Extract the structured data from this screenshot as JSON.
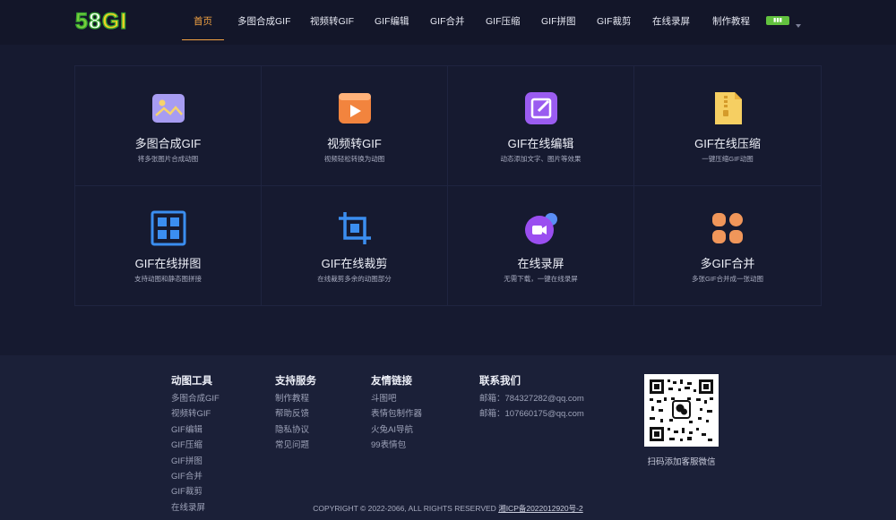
{
  "logo": {
    "chars": [
      "5",
      "8",
      "G",
      "I"
    ]
  },
  "nav": {
    "items": [
      {
        "label": "首页",
        "active": true
      },
      {
        "label": "多图合成GIF"
      },
      {
        "label": "视频转GIF"
      },
      {
        "label": "GIF编辑"
      },
      {
        "label": "GIF合并"
      },
      {
        "label": "GIF压缩"
      },
      {
        "label": "GIF拼图"
      },
      {
        "label": "GIF裁剪"
      },
      {
        "label": "在线录屏"
      },
      {
        "label": "制作教程"
      }
    ],
    "lang_icon": "language-flag-icon"
  },
  "tools": [
    {
      "title": "多图合成GIF",
      "desc": "将多张图片合成动图",
      "icon": "image-icon"
    },
    {
      "title": "视频转GIF",
      "desc": "视频轻松转换为动图",
      "icon": "video-icon"
    },
    {
      "title": "GIF在线编辑",
      "desc": "动态添加文字、图片等效果",
      "icon": "edit-icon"
    },
    {
      "title": "GIF在线压缩",
      "desc": "一键压缩GIF动图",
      "icon": "zip-icon"
    },
    {
      "title": "GIF在线拼图",
      "desc": "支持动图和静态图拼接",
      "icon": "grid-icon"
    },
    {
      "title": "GIF在线裁剪",
      "desc": "在线裁剪多余的动图部分",
      "icon": "crop-icon"
    },
    {
      "title": "在线录屏",
      "desc": "无需下载，一键在线录屏",
      "icon": "record-icon"
    },
    {
      "title": "多GIF合并",
      "desc": "多张GIF合并成一张动图",
      "icon": "merge-icon"
    }
  ],
  "footer": {
    "col1": {
      "title": "动图工具",
      "links": [
        "多图合成GIF",
        "视频转GIF",
        "GIF编辑",
        "GIF压缩",
        "GIF拼图",
        "GIF合并",
        "GIF裁剪",
        "在线录屏"
      ]
    },
    "col2": {
      "title": "支持服务",
      "links": [
        "制作教程",
        "帮助反馈",
        "隐私协议",
        "常见问题"
      ]
    },
    "col3": {
      "title": "友情链接",
      "links": [
        "斗图吧",
        "表情包制作器",
        "火兔AI导航",
        "99表情包"
      ]
    },
    "col4": {
      "title": "联系我们",
      "links": [
        "邮箱：784327282@qq.com",
        "邮箱：107660175@qq.com"
      ]
    },
    "qr_caption": "扫码添加客服微信",
    "copyright": "COPYRIGHT © 2022-2066, ALL RIGHTS RESERVED",
    "icp": "湘ICP备2022012920号-2"
  },
  "colors": {
    "accent": "#f5a443",
    "bg": "#161a30",
    "footer_bg": "#1b2038"
  }
}
